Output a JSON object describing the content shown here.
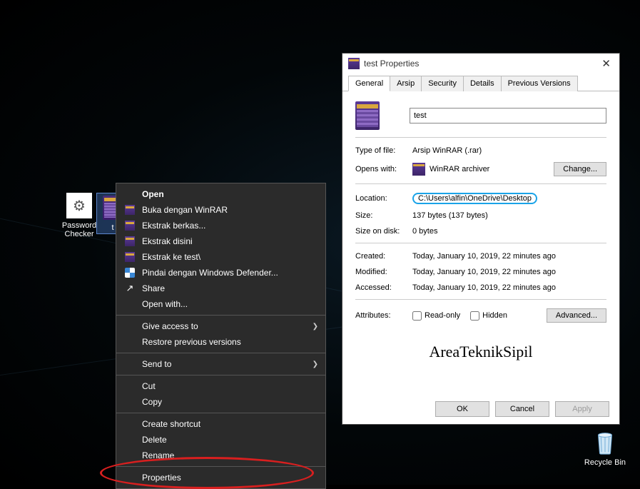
{
  "desktop": {
    "password_checker_label": "Password Checker",
    "test_file_label": "t",
    "recycle_bin_label": "Recycle Bin"
  },
  "context_menu": {
    "open": "Open",
    "buka_dengan": "Buka dengan WinRAR",
    "ekstrak_berkas": "Ekstrak berkas...",
    "ekstrak_disini": "Ekstrak disini",
    "ekstrak_ke": "Ekstrak ke test\\",
    "defender": "Pindai dengan Windows Defender...",
    "share": "Share",
    "open_with": "Open with...",
    "give_access": "Give access to",
    "restore": "Restore previous versions",
    "send_to": "Send to",
    "cut": "Cut",
    "copy": "Copy",
    "create_shortcut": "Create shortcut",
    "delete": "Delete",
    "rename": "Rename",
    "properties": "Properties"
  },
  "dialog": {
    "title": "test Properties",
    "tabs": {
      "general": "General",
      "arsip": "Arsip",
      "security": "Security",
      "details": "Details",
      "previous": "Previous Versions"
    },
    "filename": "test",
    "type_label": "Type of file:",
    "type_value": "Arsip WinRAR (.rar)",
    "opens_label": "Opens with:",
    "opens_value": "WinRAR archiver",
    "change_btn": "Change...",
    "location_label": "Location:",
    "location_value": "C:\\Users\\alfin\\OneDrive\\Desktop",
    "size_label": "Size:",
    "size_value": "137 bytes (137 bytes)",
    "size_on_disk_label": "Size on disk:",
    "size_on_disk_value": "0 bytes",
    "created_label": "Created:",
    "created_value": "Today, January 10, 2019, 22 minutes ago",
    "modified_label": "Modified:",
    "modified_value": "Today, January 10, 2019, 22 minutes ago",
    "accessed_label": "Accessed:",
    "accessed_value": "Today, January 10, 2019, 22 minutes ago",
    "attributes_label": "Attributes:",
    "readonly_label": "Read-only",
    "hidden_label": "Hidden",
    "advanced_btn": "Advanced...",
    "watermark": "AreaTeknikSipil",
    "ok_btn": "OK",
    "cancel_btn": "Cancel",
    "apply_btn": "Apply"
  }
}
